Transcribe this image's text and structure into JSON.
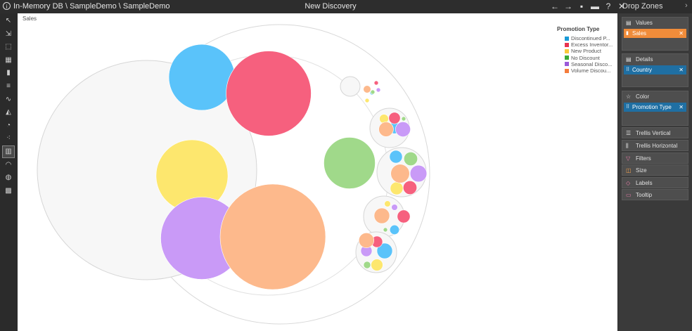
{
  "titlebar": {
    "breadcrumb": "In-Memory DB \\ SampleDemo \\ SampleDemo",
    "title": "New Discovery",
    "info_icon": "info-icon",
    "icons": [
      "back-arrow-icon",
      "forward-arrow-icon",
      "save-icon",
      "print-icon",
      "help-icon",
      "close-icon"
    ],
    "icon_glyphs": [
      "←",
      "→",
      "▪",
      "▬",
      "?",
      "✕"
    ]
  },
  "toolbar": {
    "tools": [
      {
        "name": "select-tool-icon",
        "glyph": "↖"
      },
      {
        "name": "drill-tool-icon",
        "glyph": "⇲"
      },
      {
        "name": "filter-select-icon",
        "glyph": "⬚"
      },
      {
        "name": "table-chart-icon",
        "glyph": "▦"
      },
      {
        "name": "column-chart-icon",
        "glyph": "▮"
      },
      {
        "name": "bar-chart-icon",
        "glyph": "≡"
      },
      {
        "name": "line-chart-icon",
        "glyph": "∿"
      },
      {
        "name": "area-chart-icon",
        "glyph": "◭"
      },
      {
        "name": "pie-chart-icon",
        "glyph": "◔"
      },
      {
        "name": "scatter-chart-icon",
        "glyph": "⁖"
      },
      {
        "name": "treemap-chart-icon",
        "glyph": "▥"
      },
      {
        "name": "gauge-chart-icon",
        "glyph": "◠"
      },
      {
        "name": "map-chart-icon",
        "glyph": "◍"
      },
      {
        "name": "grid-chart-icon",
        "glyph": "▩"
      }
    ],
    "active_index": 10
  },
  "canvas": {
    "measure_label": "Sales"
  },
  "legend": {
    "title": "Promotion Type",
    "items": [
      {
        "label": "Discontinued P...",
        "color": "#1a9ad6"
      },
      {
        "label": "Excess Inventor...",
        "color": "#e8334f"
      },
      {
        "label": "New Product",
        "color": "#f9c93b"
      },
      {
        "label": "No Discount",
        "color": "#3aaa35"
      },
      {
        "label": "Seasonal Disco...",
        "color": "#9b59d9"
      },
      {
        "label": "Volume Discou...",
        "color": "#f47c3c"
      }
    ]
  },
  "chart_data": {
    "type": "bubble-pack",
    "measure": "Sales",
    "group_by": "Country",
    "color_by": "Promotion Type",
    "series": [
      "Discontinued P...",
      "Excess Inventor...",
      "New Product",
      "No Discount",
      "Seasonal Disco...",
      "Volume Discou..."
    ],
    "groups": [
      {
        "relative_values": {
          "Discontinued P...": 0.38,
          "Excess Inventor...": 0.63,
          "New Product": 0.45,
          "No Discount": 0.23,
          "Seasonal Disco...": 0.59,
          "Volume Discou...": 0.97
        }
      },
      {
        "relative_values": {
          "Discontinued P...": 0.0022,
          "Excess Inventor...": 0.0042,
          "New Product": 0.0042,
          "No Discount": 0.0008,
          "Seasonal Disco...": 0.0032,
          "Volume Discou...": 0.021
        }
      },
      {
        "relative_values": {
          "Discontinued P...": 0.013,
          "Excess Inventor...": 0.013,
          "New Product": 0.008,
          "No Discount": 0.0016,
          "Seasonal Disco...": 0.022,
          "Volume Discou...": 0.021
        }
      },
      {
        "relative_values": {
          "Discontinued P...": 0.014,
          "Excess Inventor...": 0.016,
          "New Product": 0.014,
          "No Discount": 0.016,
          "Seasonal Disco...": 0.024,
          "Volume Discou...": 0.03
        }
      },
      {
        "relative_values": {
          "Discontinued P...": 0.012,
          "Excess Inventor...": 0.022,
          "New Product": 0.005,
          "No Discount": 0.0016,
          "Seasonal Disco...": 0.005,
          "Volume Discou...": 0.032
        }
      },
      {
        "relative_values": {
          "Discontinued P...": 0.019,
          "Excess Inventor...": 0.01,
          "New Product": 0.011,
          "No Discount": 0.004,
          "Seasonal Disco...": 0.01,
          "Volume Discou...": 0.018
        }
      }
    ]
  },
  "dropzones": {
    "title": "Drop Zones",
    "values": {
      "label": "Values",
      "chip": "Sales"
    },
    "details": {
      "label": "Details",
      "chip": "Country"
    },
    "color": {
      "label": "Color",
      "chip": "Promotion Type"
    },
    "rows": [
      "Trellis Vertical",
      "Trellis Horizontal",
      "Filters",
      "Size",
      "Labels",
      "Tooltip"
    ],
    "remove_glyph": "✕"
  },
  "colors": {
    "accent_orange": "#f08c3a",
    "chip_blue": "#1f6fa3"
  }
}
